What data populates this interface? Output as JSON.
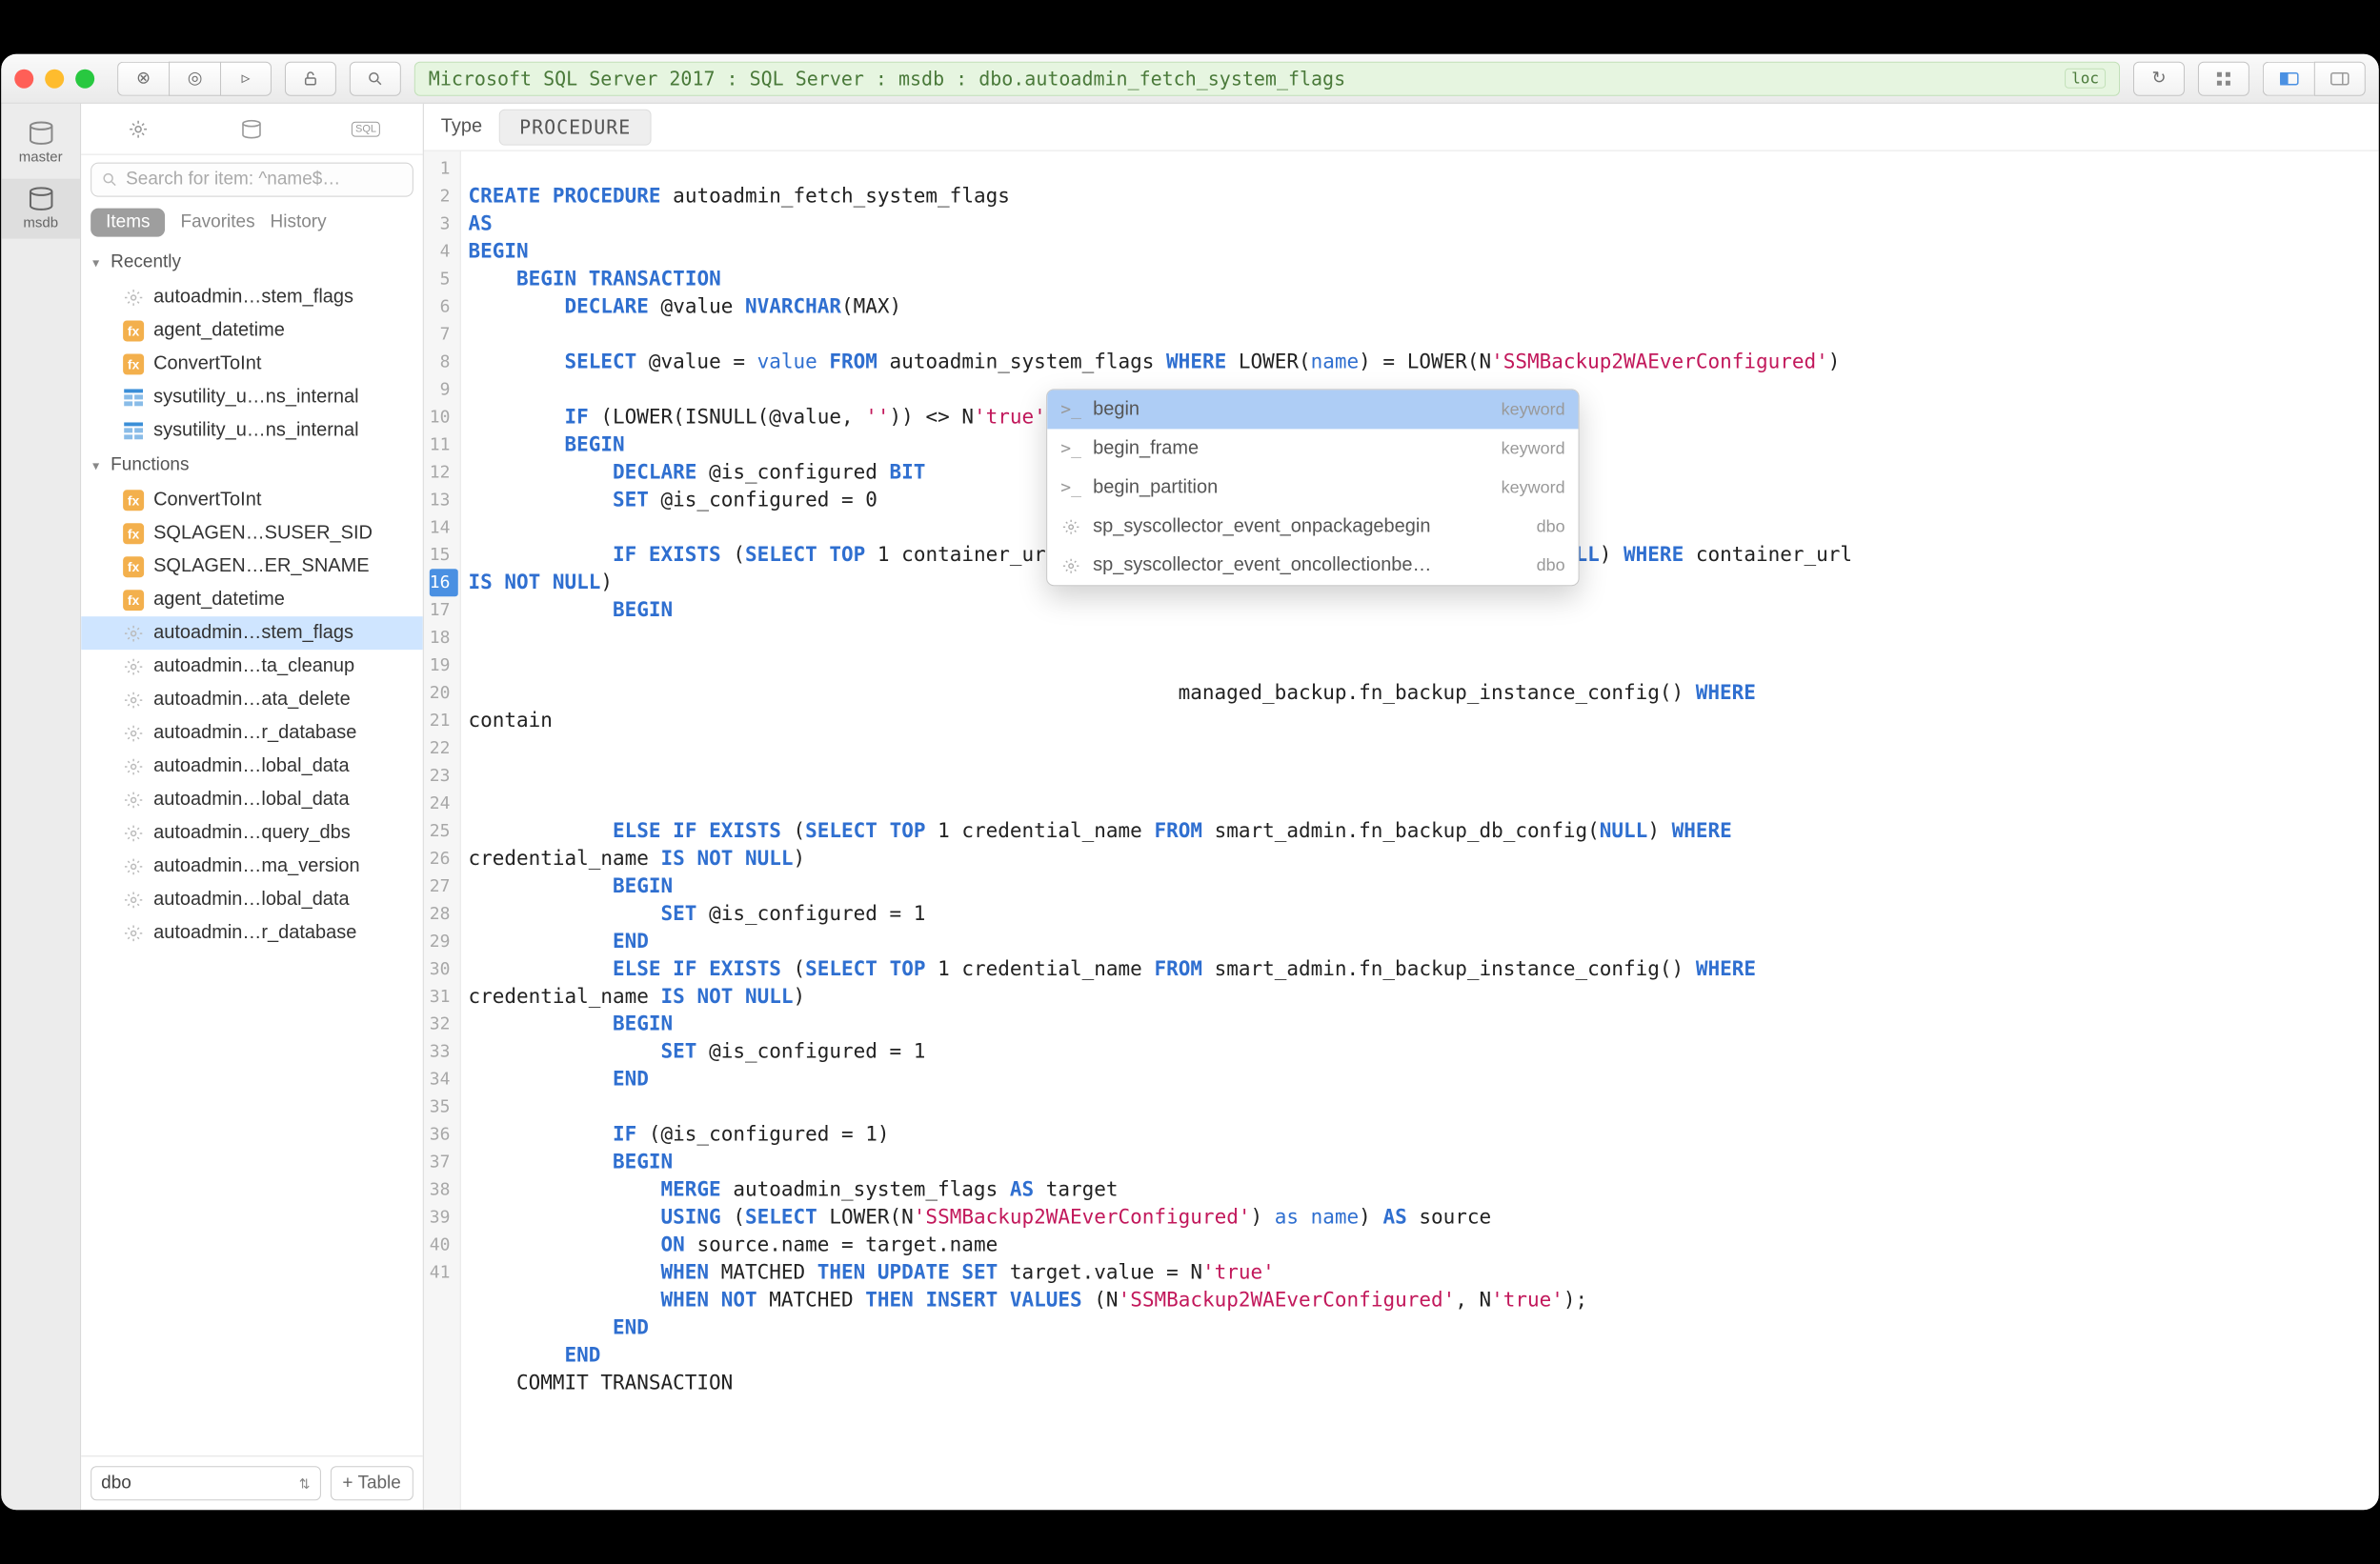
{
  "breadcrumb": "Microsoft SQL Server 2017 : SQL Server : msdb : dbo.autoadmin_fetch_system_flags",
  "loc_badge": "loc",
  "rail": [
    {
      "label": "master"
    },
    {
      "label": "msdb"
    }
  ],
  "search_placeholder": "Search for item: ^name$…",
  "filter_tabs": {
    "items": "Items",
    "favorites": "Favorites",
    "history": "History"
  },
  "tree": {
    "recently_label": "Recently",
    "recently": [
      {
        "icon": "gear",
        "label": "autoadmin…stem_flags"
      },
      {
        "icon": "fn",
        "label": "agent_datetime"
      },
      {
        "icon": "fn",
        "label": "ConvertToInt"
      },
      {
        "icon": "tbl",
        "label": "sysutility_u…ns_internal"
      },
      {
        "icon": "tbl",
        "label": "sysutility_u…ns_internal"
      }
    ],
    "functions_label": "Functions",
    "functions": [
      {
        "icon": "fn",
        "label": "ConvertToInt"
      },
      {
        "icon": "fn",
        "label": "SQLAGEN…SUSER_SID"
      },
      {
        "icon": "fn",
        "label": "SQLAGEN…ER_SNAME"
      },
      {
        "icon": "fn",
        "label": "agent_datetime"
      },
      {
        "icon": "gear",
        "label": "autoadmin…stem_flags",
        "selected": true
      },
      {
        "icon": "gear",
        "label": "autoadmin…ta_cleanup"
      },
      {
        "icon": "gear",
        "label": "autoadmin…ata_delete"
      },
      {
        "icon": "gear",
        "label": "autoadmin…r_database"
      },
      {
        "icon": "gear",
        "label": "autoadmin…lobal_data"
      },
      {
        "icon": "gear",
        "label": "autoadmin…lobal_data"
      },
      {
        "icon": "gear",
        "label": "autoadmin…query_dbs"
      },
      {
        "icon": "gear",
        "label": "autoadmin…ma_version"
      },
      {
        "icon": "gear",
        "label": "autoadmin…lobal_data"
      },
      {
        "icon": "gear",
        "label": "autoadmin…r_database"
      }
    ]
  },
  "footer": {
    "schema": "dbo",
    "add_table": "+ Table"
  },
  "type_label": "Type",
  "type_value": "PROCEDURE",
  "autocomplete": [
    {
      "label": "begin",
      "kind": "keyword",
      "icon": "kw",
      "selected": true
    },
    {
      "label": "begin_frame",
      "kind": "keyword",
      "icon": "kw"
    },
    {
      "label": "begin_partition",
      "kind": "keyword",
      "icon": "kw"
    },
    {
      "label": "sp_syscollector_event_onpackagebegin",
      "kind": "dbo",
      "icon": "gear"
    },
    {
      "label": "sp_syscollector_event_oncollectionbe…",
      "kind": "dbo",
      "icon": "gear"
    }
  ],
  "code_lines_count": 41
}
